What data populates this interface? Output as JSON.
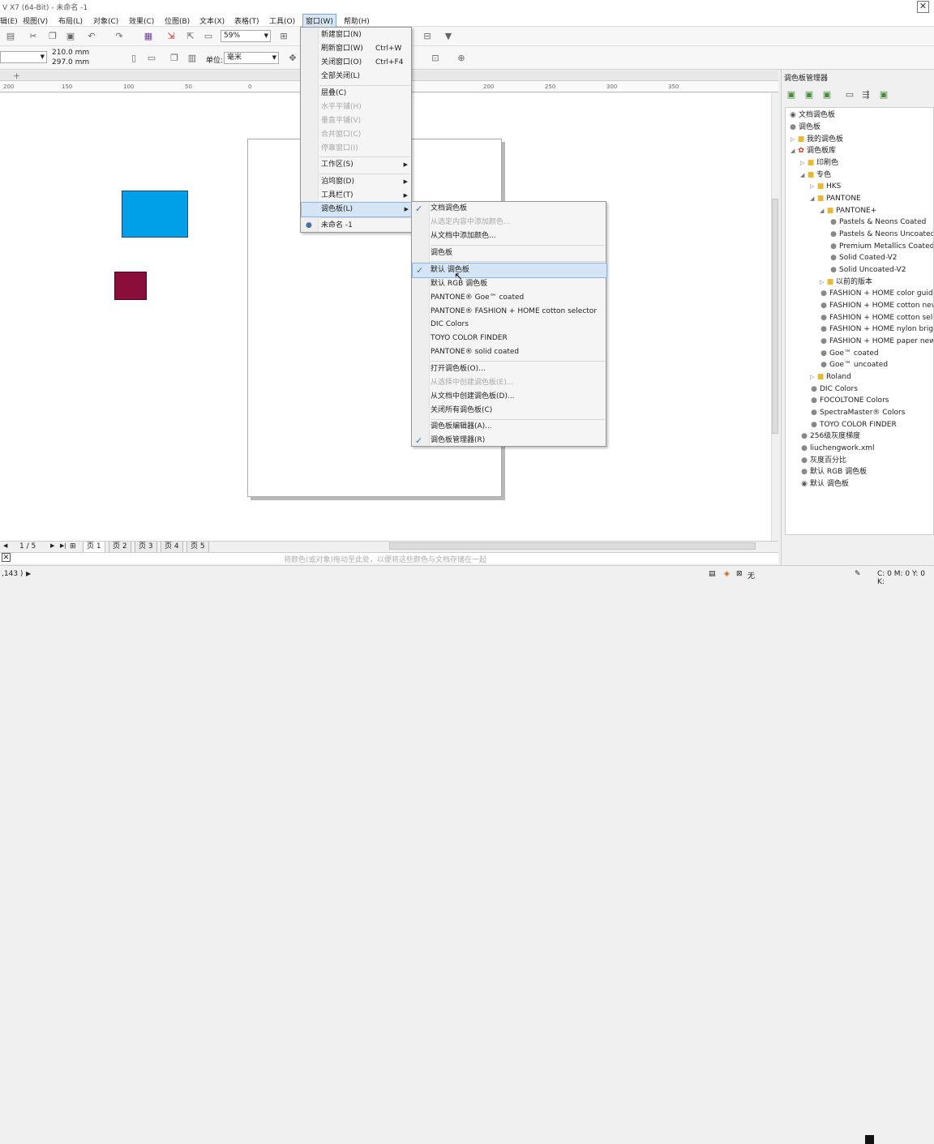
{
  "window": {
    "title": "V X7 (64-Bit) - 未命名 -1",
    "close": "✕"
  },
  "menubar": [
    {
      "label": "辑(E)"
    },
    {
      "label": "视图(V)"
    },
    {
      "label": "布局(L)"
    },
    {
      "label": "对象(C)"
    },
    {
      "label": "效果(C)"
    },
    {
      "label": "位图(B)"
    },
    {
      "label": "文本(X)"
    },
    {
      "label": "表格(T)"
    },
    {
      "label": "工具(O)"
    },
    {
      "label": "窗口(W)"
    },
    {
      "label": "帮助(H)"
    }
  ],
  "toolbar": {
    "zoom": "59%",
    "width": "210.0 mm",
    "height": "297.0 mm",
    "unit_label": "单位:",
    "unit_value": "毫米"
  },
  "ruler_ticks": [
    "200",
    "150",
    "100",
    "50",
    "0",
    "50",
    "200",
    "250",
    "300",
    "350"
  ],
  "window_menu": [
    {
      "label": "新建窗口(N)",
      "shortcut": "",
      "disabled": false
    },
    {
      "label": "刷新窗口(W)",
      "shortcut": "Ctrl+W",
      "disabled": false
    },
    {
      "label": "关闭窗口(O)",
      "shortcut": "Ctrl+F4",
      "disabled": false
    },
    {
      "label": "全部关闭(L)",
      "shortcut": "",
      "disabled": false
    },
    {
      "label": "层叠(C)",
      "shortcut": "",
      "disabled": false
    },
    {
      "label": "水平平铺(H)",
      "shortcut": "",
      "disabled": true
    },
    {
      "label": "垂直平铺(V)",
      "shortcut": "",
      "disabled": true
    },
    {
      "label": "合并窗口(C)",
      "shortcut": "",
      "disabled": true
    },
    {
      "label": "停靠窗口(I)",
      "shortcut": "",
      "disabled": true
    },
    {
      "label": "工作区(S)",
      "shortcut": "",
      "disabled": false
    },
    {
      "label": "泊坞窗(D)",
      "shortcut": "",
      "disabled": false
    },
    {
      "label": "工具栏(T)",
      "shortcut": "",
      "disabled": false
    },
    {
      "label": "调色板(L)",
      "shortcut": "",
      "disabled": false
    },
    {
      "label": "未命名 -1",
      "shortcut": "",
      "disabled": false
    }
  ],
  "palette_menu": [
    {
      "label": "文档调色板",
      "checked": true,
      "disabled": false
    },
    {
      "label": "从选定内容中添加颜色...",
      "checked": false,
      "disabled": true
    },
    {
      "label": "从文档中添加颜色...",
      "checked": false,
      "disabled": false
    },
    {
      "label": "调色板",
      "checked": false,
      "disabled": false
    },
    {
      "label": "默认 调色板",
      "checked": true,
      "disabled": false
    },
    {
      "label": "默认 RGB 调色板",
      "checked": false,
      "disabled": false
    },
    {
      "label": "PANTONE® Goe™ coated",
      "checked": false,
      "disabled": false
    },
    {
      "label": "PANTONE® FASHION + HOME cotton selector",
      "checked": false,
      "disabled": false
    },
    {
      "label": "DIC Colors",
      "checked": false,
      "disabled": false
    },
    {
      "label": "TOYO COLOR FINDER",
      "checked": false,
      "disabled": false
    },
    {
      "label": "PANTONE® solid coated",
      "checked": false,
      "disabled": false
    },
    {
      "label": "打开调色板(O)...",
      "checked": false,
      "disabled": false
    },
    {
      "label": "从选择中创建调色板(E)...",
      "checked": false,
      "disabled": true
    },
    {
      "label": "从文档中创建调色板(D)...",
      "checked": false,
      "disabled": false
    },
    {
      "label": "关闭所有调色板(C)",
      "checked": false,
      "disabled": false
    },
    {
      "label": "调色板编辑器(A)...",
      "checked": false,
      "disabled": false
    },
    {
      "label": "调色板管理器(R)",
      "checked": true,
      "disabled": false
    }
  ],
  "panel": {
    "title": "调色板管理器",
    "tree": [
      "文档调色板",
      "调色板",
      "我的调色板",
      "调色板库",
      "印刷色",
      "专色",
      "HKS",
      "PANTONE",
      "PANTONE+",
      "Pastels & Neons Coated",
      "Pastels & Neons Uncoated",
      "Premium Metallics Coated",
      "Solid Coated-V2",
      "Solid Uncoated-V2",
      "以前的版本",
      "FASHION + HOME color guide",
      "FASHION + HOME cotton new",
      "FASHION + HOME cotton selector",
      "FASHION + HOME nylon bright",
      "FASHION + HOME paper new c",
      "Goe™ coated",
      "Goe™ uncoated",
      "Roland",
      "DIC Colors",
      "FOCOLTONE Colors",
      "SpectraMaster® Colors",
      "TOYO COLOR FINDER",
      "256级灰度梯度",
      "liuchengwork.xml",
      "灰度百分比",
      "默认 RGB 调色板",
      "默认 调色板"
    ]
  },
  "pagenav": {
    "counter": "1 / 5",
    "tabs": [
      "页 1",
      "页 2",
      "页 3",
      "页 4",
      "页 5"
    ]
  },
  "colorbar_hint": "将颜色(或对象)拖动至此处，以便将这些颜色与文档存储在一起",
  "status": {
    "left": ",143 )",
    "fill": "无",
    "cmyk": "C: 0 M: 0 Y: 0 K:"
  },
  "colors": {
    "blue_rect": "#00a0e9",
    "red_rect": "#8b0e3a",
    "menu_highlight": "#d5e5f6"
  }
}
